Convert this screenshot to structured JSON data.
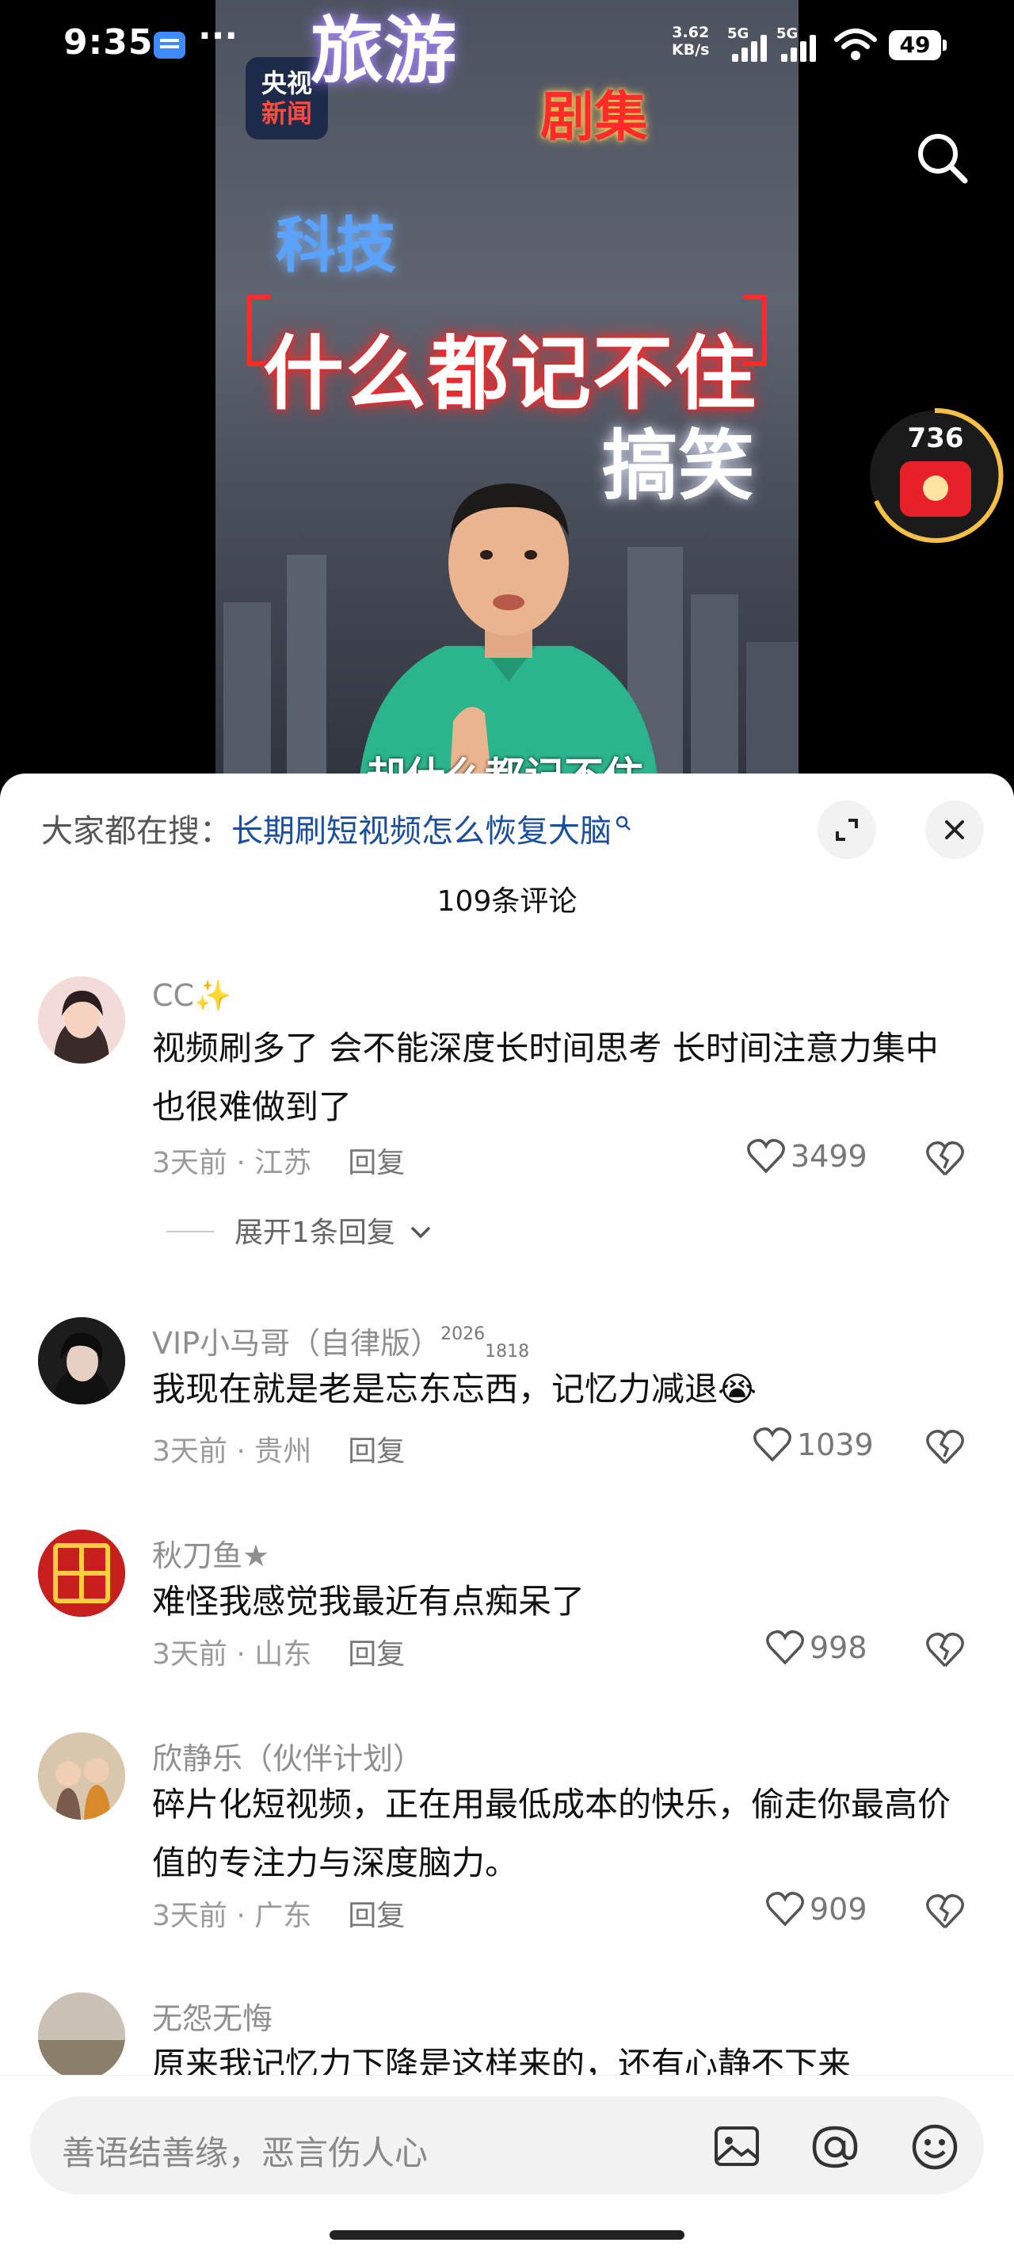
{
  "status_bar": {
    "time": "9:35",
    "dots": "···",
    "net_speed_value": "3.62",
    "net_speed_unit": "KB/s",
    "signal1_label": "5G",
    "signal2_label": "5G",
    "battery": "49"
  },
  "video": {
    "logo_line1": "央视",
    "logo_line2": "新闻",
    "tag_travel": "旅游",
    "tag_drama": "剧集",
    "tag_tech": "科技",
    "headline": "什么都记不住",
    "tag_funny": "搞笑",
    "subtitle": "却什么都记不住",
    "reward_count": "736"
  },
  "panel": {
    "trending_label": "大家都在搜：",
    "trending_query": "长期刷短视频怎么恢复大脑",
    "comment_count": "109条评论",
    "input_placeholder": "善语结善缘，恶言伤人心"
  },
  "comments": [
    {
      "name": "CC✨",
      "text": "视频刷多了 会不能深度长时间思考 长时间注意力集中也很难做到了",
      "time": "3天前",
      "location": "江苏",
      "reply": "回复",
      "likes": "3499",
      "expand": "展开1条回复"
    },
    {
      "name": "VIP小马哥（自律版）",
      "badge_sup": "2026",
      "badge_sub": "1818",
      "text": "我现在就是老是忘东忘西，记忆力减退😭",
      "time": "3天前",
      "location": "贵州",
      "reply": "回复",
      "likes": "1039"
    },
    {
      "name": "秋刀鱼★",
      "text": "难怪我感觉我最近有点痴呆了",
      "time": "3天前",
      "location": "山东",
      "reply": "回复",
      "likes": "998"
    },
    {
      "name": "欣静乐（伙伴计划）",
      "text": "碎片化短视频，正在用最低成本的快乐，偷走你最高价值的专注力与深度脑力。",
      "time": "3天前",
      "location": "广东",
      "reply": "回复",
      "likes": "909"
    },
    {
      "name": "无怨无悔",
      "text": "原来我记忆力下降是这样来的，还有心静不下来"
    }
  ],
  "colors": {
    "link_blue": "#1a4fa0",
    "meta_gray": "#9a9a9a",
    "headline_glow": "#ff2020"
  },
  "icons": [
    "search-icon",
    "expand-icon",
    "close-icon",
    "heart-icon",
    "broken-heart-icon",
    "chevron-down-icon",
    "image-icon",
    "at-icon",
    "emoji-icon",
    "red-packet-icon"
  ]
}
